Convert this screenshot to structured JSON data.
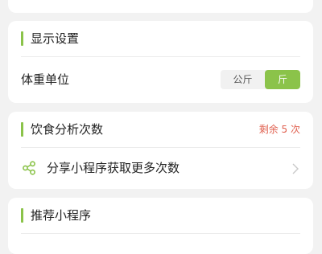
{
  "display_settings": {
    "title": "显示设置",
    "weight_unit_label": "体重单位",
    "unit_options": [
      "公斤",
      "斤"
    ],
    "selected_unit": "斤"
  },
  "diet_analysis": {
    "title": "饮食分析次数",
    "remaining_text": "剩余 5 次",
    "share_label": "分享小程序获取更多次数"
  },
  "recommend": {
    "title": "推荐小程序"
  },
  "colors": {
    "accent": "#8bc34a",
    "remaining": "#e0604f",
    "background": "#f2f2f2"
  },
  "icons": [
    "share-icon",
    "chevron-right-icon"
  ]
}
